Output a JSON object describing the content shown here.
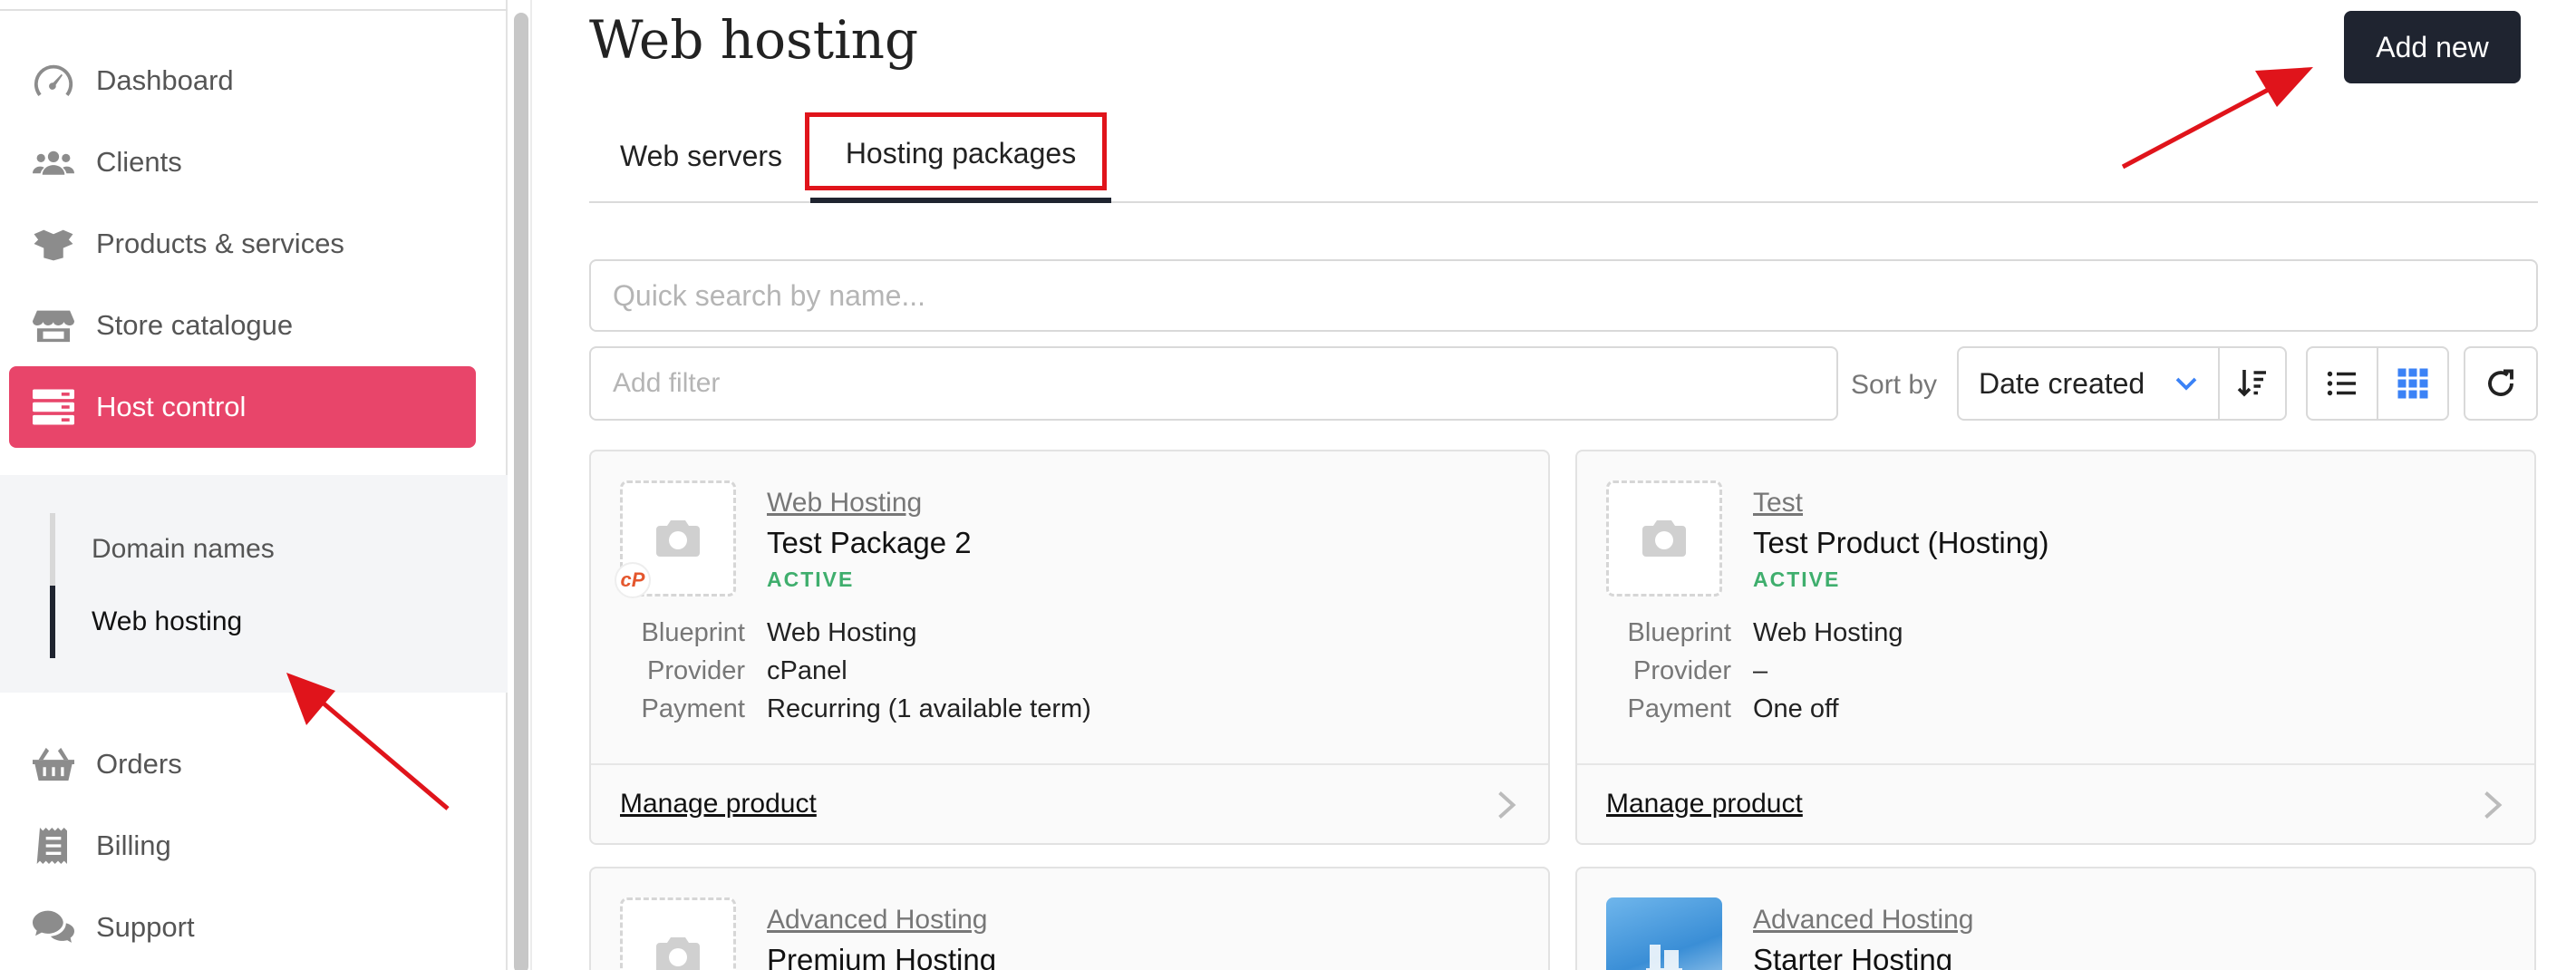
{
  "sidebar": {
    "items": [
      {
        "label": "Dashboard",
        "icon": "gauge-icon"
      },
      {
        "label": "Clients",
        "icon": "users-icon"
      },
      {
        "label": "Products & services",
        "icon": "box-icon"
      },
      {
        "label": "Store catalogue",
        "icon": "store-icon"
      },
      {
        "label": "Host control",
        "icon": "server-icon",
        "active": true
      },
      {
        "label": "Orders",
        "icon": "basket-icon"
      },
      {
        "label": "Billing",
        "icon": "receipt-icon"
      },
      {
        "label": "Support",
        "icon": "chat-icon"
      }
    ],
    "subitems": [
      {
        "label": "Domain names"
      },
      {
        "label": "Web hosting",
        "active": true
      }
    ]
  },
  "header": {
    "title": "Web hosting",
    "add_label": "Add new"
  },
  "tabs": [
    {
      "label": "Web servers"
    },
    {
      "label": "Hosting packages",
      "active": true
    }
  ],
  "search": {
    "placeholder": "Quick search by name..."
  },
  "filter": {
    "placeholder": "Add filter"
  },
  "sort": {
    "label": "Sort by",
    "value": "Date created"
  },
  "colors": {
    "accent": "#e8456a",
    "dark": "#1f2430",
    "active_status": "#3fae6d",
    "annotation": "#e0141b"
  },
  "cards": [
    {
      "category": "Web Hosting",
      "name": "Test Package 2",
      "status": "ACTIVE",
      "badge": "cP",
      "meta": [
        {
          "k": "Blueprint",
          "v": "Web Hosting"
        },
        {
          "k": "Provider",
          "v": "cPanel"
        },
        {
          "k": "Payment",
          "v": "Recurring (1 available term)"
        }
      ],
      "manage": "Manage product"
    },
    {
      "category": "Test",
      "name": "Test Product (Hosting)",
      "status": "ACTIVE",
      "meta": [
        {
          "k": "Blueprint",
          "v": "Web Hosting"
        },
        {
          "k": "Provider",
          "v": "–"
        },
        {
          "k": "Payment",
          "v": "One off"
        }
      ],
      "manage": "Manage product"
    },
    {
      "category": "Advanced Hosting",
      "name": "Premium Hosting"
    },
    {
      "category": "Advanced Hosting",
      "name": "Starter Hosting"
    }
  ]
}
